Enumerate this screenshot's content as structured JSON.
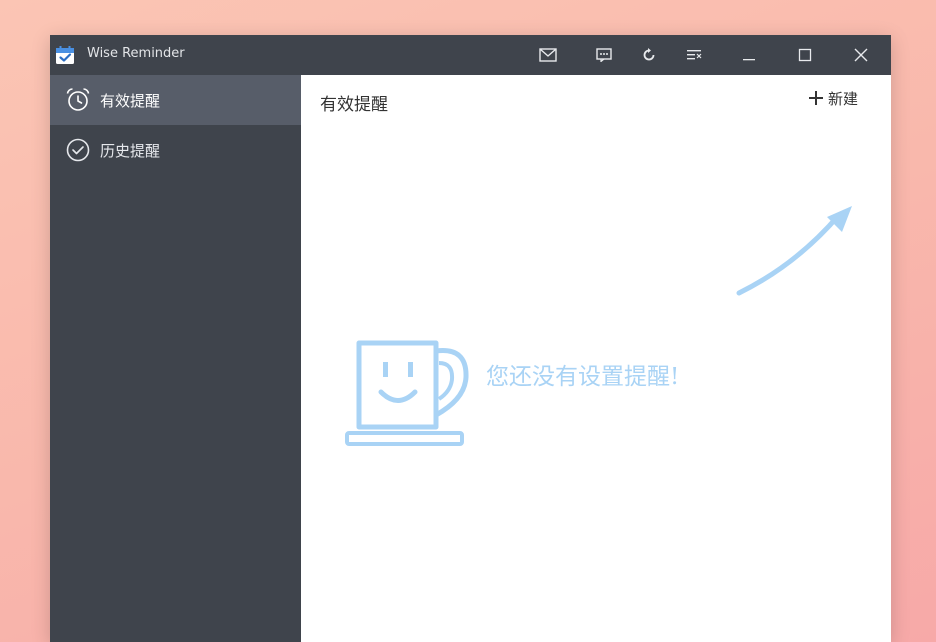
{
  "window": {
    "title": "Wise Reminder",
    "app_icon": "calendar-check-icon"
  },
  "titlebar": {
    "buttons": [
      {
        "name": "mail-icon"
      },
      {
        "name": "feedback-icon"
      },
      {
        "name": "refresh-icon"
      },
      {
        "name": "menu-icon"
      },
      {
        "name": "minimize-icon"
      },
      {
        "name": "maximize-icon"
      },
      {
        "name": "close-icon"
      }
    ]
  },
  "sidebar": {
    "items": [
      {
        "label": "有效提醒",
        "icon": "alarm-clock-icon",
        "active": true
      },
      {
        "label": "历史提醒",
        "icon": "check-circle-icon",
        "active": false
      }
    ]
  },
  "main": {
    "title": "有效提醒",
    "new_label": "新建",
    "empty_message": "您还没有设置提醒!"
  },
  "colors": {
    "titlebar_bg": "#3f444c",
    "sidebar_bg": "#3f444c",
    "sidebar_active_bg": "#575d69",
    "accent_light_blue": "#a9d3f5"
  }
}
